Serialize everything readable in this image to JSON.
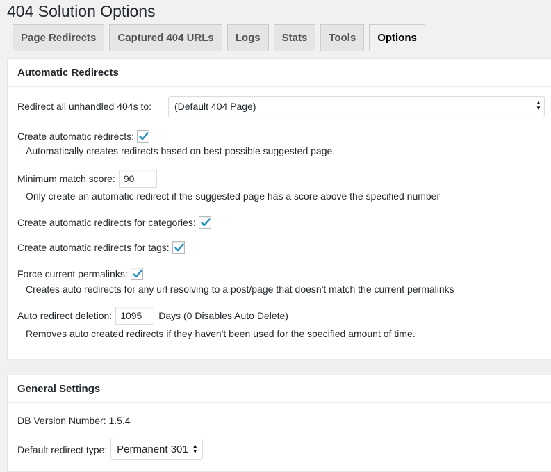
{
  "page": {
    "title": "404 Solution Options"
  },
  "tabs": [
    {
      "label": "Page Redirects",
      "active": false
    },
    {
      "label": "Captured 404 URLs",
      "active": false
    },
    {
      "label": "Logs",
      "active": false
    },
    {
      "label": "Stats",
      "active": false
    },
    {
      "label": "Tools",
      "active": false
    },
    {
      "label": "Options",
      "active": true
    }
  ],
  "automatic_redirects": {
    "heading": "Automatic Redirects",
    "redirect_unhandled": {
      "label": "Redirect all unhandled 404s to:",
      "value": "(Default 404 Page)"
    },
    "create_auto": {
      "label": "Create automatic redirects:",
      "checked": true,
      "description": "Automatically creates redirects based on best possible suggested page."
    },
    "min_score": {
      "label": "Minimum match score:",
      "value": "90",
      "description": "Only create an automatic redirect if the suggested page has a score above the specified number"
    },
    "categories": {
      "label": "Create automatic redirects for categories:",
      "checked": true
    },
    "tags": {
      "label": "Create automatic redirects for tags:",
      "checked": true
    },
    "permalinks": {
      "label": "Force current permalinks:",
      "checked": true,
      "description": "Creates auto redirects for any url resolving to a post/page that doesn't match the current permalinks"
    },
    "deletion": {
      "label": "Auto redirect deletion:",
      "value": "1095",
      "suffix": "Days (0 Disables Auto Delete)",
      "description": "Removes auto created redirects if they haven't been used for the specified amount of time."
    }
  },
  "general_settings": {
    "heading": "General Settings",
    "db_version": "DB Version Number: 1.5.4",
    "redirect_type": {
      "label": "Default redirect type:",
      "value": "Permanent 301"
    }
  },
  "colors": {
    "checkmark": "#1e8cbe",
    "background": "#f1f1f1",
    "tab_bg": "#e5e5e5"
  }
}
